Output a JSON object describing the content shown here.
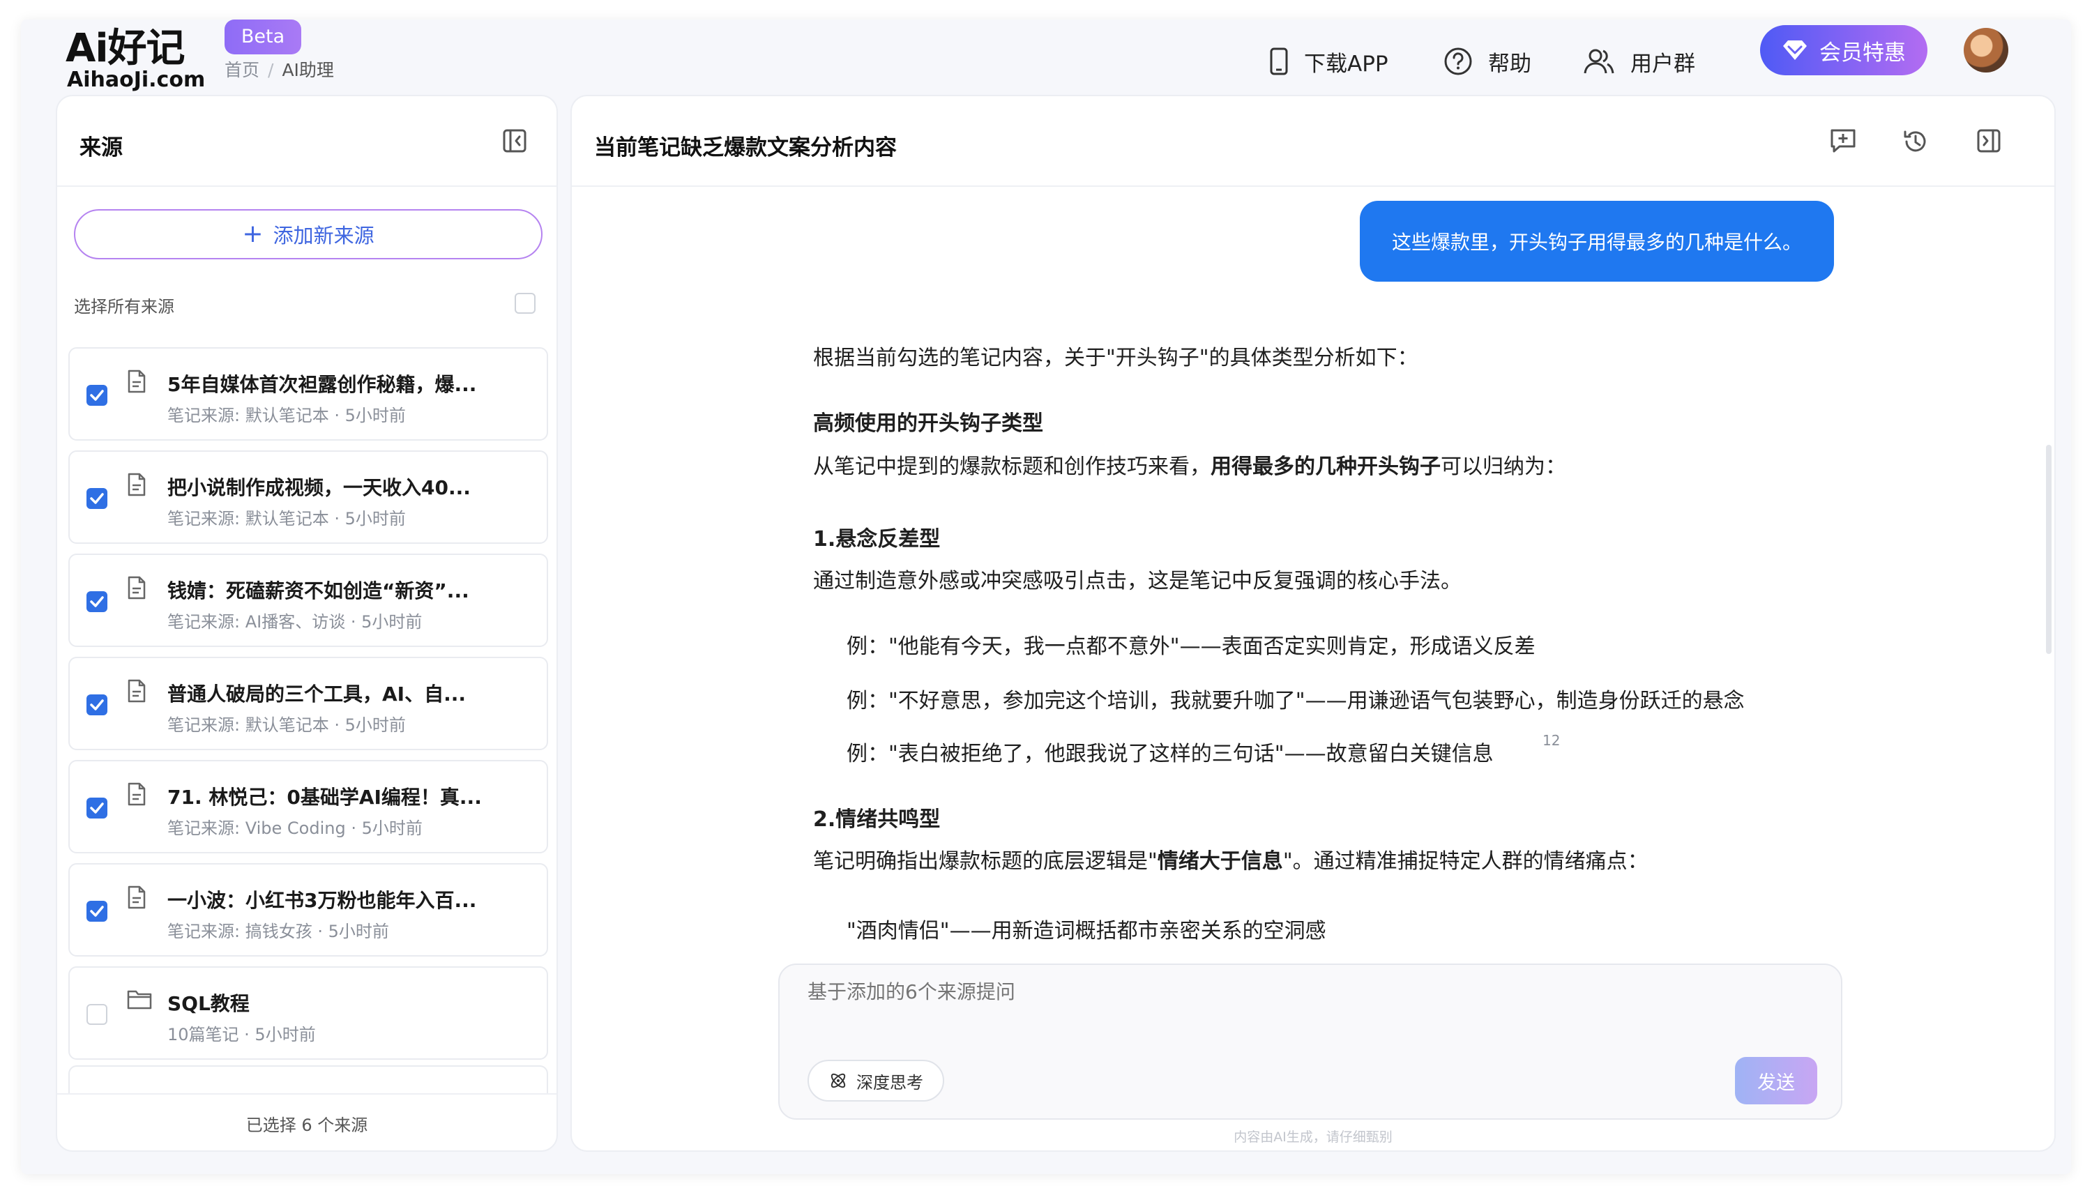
{
  "header": {
    "logo_main": "Ai好记",
    "logo_sub": "AihaoJi.com",
    "badge": "Beta",
    "breadcrumb": [
      "首页",
      "AI助理"
    ],
    "breadcrumb_sep": "/",
    "nav": {
      "download": "下载APP",
      "help": "帮助",
      "group": "用户群",
      "vip": "会员特惠"
    }
  },
  "sidebar": {
    "title": "来源",
    "add_source": "添加新来源",
    "select_all": "选择所有来源",
    "items": [
      {
        "title": "5年自媒体首次袒露创作秘籍，爆...",
        "meta": "笔记来源: 默认笔记本 · 5小时前",
        "checked": true,
        "icon": "document-icon"
      },
      {
        "title": "把小说制作成视频，一天收入40...",
        "meta": "笔记来源: 默认笔记本 · 5小时前",
        "checked": true,
        "icon": "document-icon"
      },
      {
        "title": "钱婧：死磕薪资不如创造“新资”...",
        "meta": "笔记来源: AI播客、访谈 · 5小时前",
        "checked": true,
        "icon": "document-icon"
      },
      {
        "title": "普通人破局的三个工具，AI、自...",
        "meta": "笔记来源: 默认笔记本 · 5小时前",
        "checked": true,
        "icon": "document-icon"
      },
      {
        "title": "71. 林悦己：0基础学AI编程！真...",
        "meta": "笔记来源: Vibe Coding · 5小时前",
        "checked": true,
        "icon": "document-icon"
      },
      {
        "title": "一小波：小红书3万粉也能年入百...",
        "meta": "笔记来源: 搞钱女孩 · 5小时前",
        "checked": true,
        "icon": "document-icon"
      },
      {
        "title": "SQL教程",
        "meta": "10篇笔记 · 5小时前",
        "checked": false,
        "icon": "folder-icon"
      }
    ],
    "footer": "已选择 6 个来源"
  },
  "chat": {
    "title": "当前笔记缺乏爆款文案分析内容",
    "user_message": "这些爆款里，开头钩子用得最多的几种是什么。",
    "answer": {
      "intro": "根据当前勾选的笔记内容，关于\"开头钩子\"的具体类型分析如下：",
      "h1": "高频使用的开头钩子类型",
      "p1_pre": "从笔记中提到的爆款标题和创作技巧来看，",
      "p1_bold": "用得最多的几种开头钩子",
      "p1_post": "可以归纳为：",
      "s1_title": "1.悬念反差型",
      "s1_desc": "通过制造意外感或冲突感吸引点击，这是笔记中反复强调的核心手法。",
      "s1_ex1": "例：\"他能有今天，我一点都不意外\"——表面否定实则肯定，形成语义反差",
      "s1_ex2": "例：\"不好意思，参加完这个培训，我就要升咖了\"——用谦逊语气包装野心，制造身份跃迁的悬念",
      "s1_ex3": "例：\"表白被拒绝了，他跟我说了这样的三句话\"——故意留白关键信息",
      "s1_ex3_ref": "12",
      "s2_title": "2.情绪共鸣型",
      "s2_desc_pre": "笔记明确指出爆款标题的底层逻辑是\"",
      "s2_desc_bold": "情绪大于信息",
      "s2_desc_post": "\"。通过精准捕捉特定人群的情绪痛点：",
      "s2_ex1": "\"酒肉情侣\"——用新造词概括都市亲密关系的空洞感"
    },
    "input_placeholder": "基于添加的6个来源提问",
    "deep_think": "深度思考",
    "send": "发送",
    "disclaimer": "内容由AI生成，请仔细甄别"
  },
  "colors": {
    "accent_blue": "#1f78f0",
    "checkbox_blue": "#2f6fe4",
    "vip_gradient_start": "#4f5af5",
    "vip_gradient_end": "#b36cf2"
  }
}
